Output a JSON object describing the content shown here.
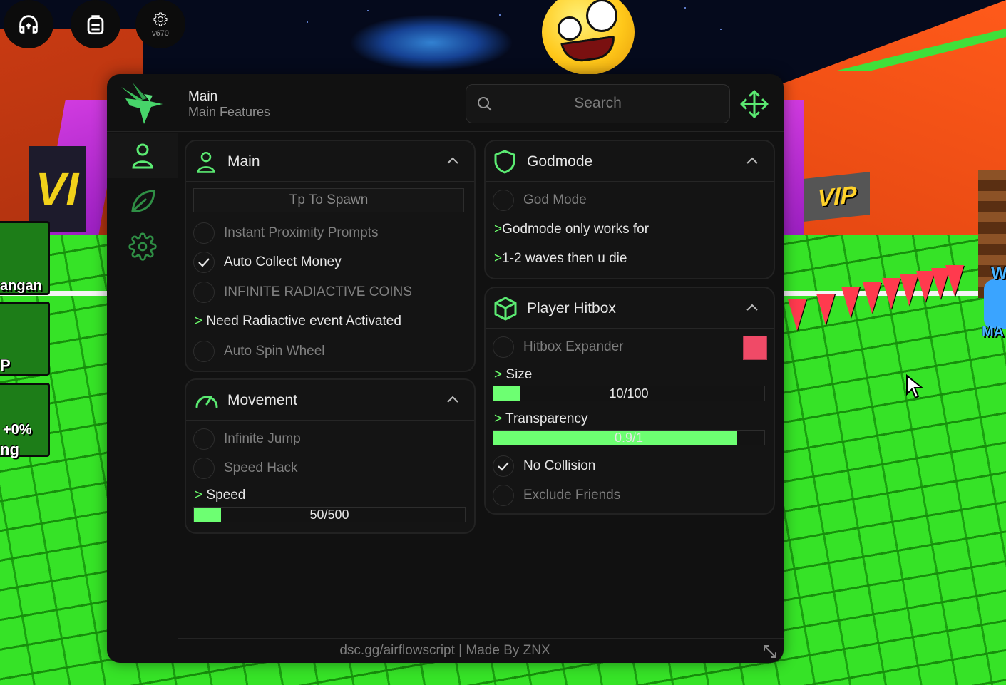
{
  "topbar_buttons": [
    {
      "name": "headphones-icon"
    },
    {
      "name": "backpack-icon"
    },
    {
      "name": "gear-icon",
      "caption": "v670"
    }
  ],
  "game_left_labels": [
    "angan",
    "P",
    "+0%",
    "ng"
  ],
  "game_signs": {
    "vip_right": "VIP",
    "vip_left": "VI",
    "right_tag": "W",
    "right_tag2": "MA"
  },
  "window": {
    "title": "Main",
    "subtitle": "Main Features",
    "search_placeholder": "Search",
    "footer": "dsc.gg/airflowscript | Made By ZNX",
    "sidebar": [
      {
        "name": "user-icon",
        "active": true
      },
      {
        "name": "leaf-icon",
        "active": false
      },
      {
        "name": "gear-icon",
        "active": false
      }
    ]
  },
  "sections": {
    "main": {
      "title": "Main",
      "button": "Tp To Spawn",
      "toggles": [
        {
          "label": "Instant Proximity Prompts",
          "checked": false
        },
        {
          "label": "Auto Collect Money",
          "checked": true
        },
        {
          "label": "INFINITE RADIACTIVE COINS",
          "checked": false
        },
        {
          "label": "Auto Spin Wheel",
          "checked": false
        }
      ],
      "note": "Need Radiactive event Activated"
    },
    "movement": {
      "title": "Movement",
      "toggles": [
        {
          "label": "Infinite Jump",
          "checked": false
        },
        {
          "label": "Speed Hack",
          "checked": false
        }
      ],
      "slider_label": "Speed",
      "slider_value": "50/500",
      "slider_fraction": 0.1
    },
    "godmode": {
      "title": "Godmode",
      "toggles": [
        {
          "label": "God Mode",
          "checked": false
        }
      ],
      "notes": [
        "Godmode only works for",
        "1-2 waves then u die"
      ]
    },
    "hitbox": {
      "title": "Player Hitbox",
      "toggles": [
        {
          "label": "Hitbox Expander",
          "checked": false
        },
        {
          "label": "No Collision",
          "checked": true
        },
        {
          "label": "Exclude Friends",
          "checked": false
        }
      ],
      "color": "#f04a67",
      "size_label": "Size",
      "size_value": "10/100",
      "size_fraction": 0.1,
      "transparency_label": "Transparency",
      "transparency_value": "0.9/1",
      "transparency_fraction": 0.9
    }
  },
  "colors": {
    "accent": "#6dff72",
    "window_bg": "#111111"
  },
  "note_prefix": ">"
}
